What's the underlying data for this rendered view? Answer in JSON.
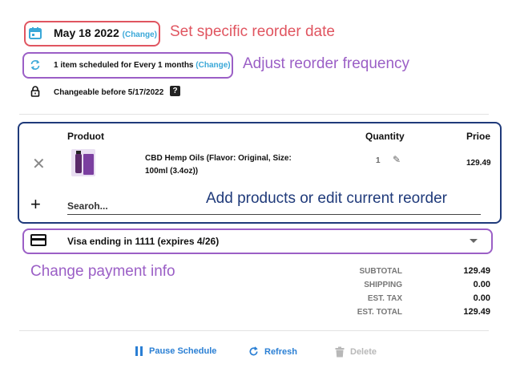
{
  "schedule": {
    "date": "May 18 2022",
    "date_change_label": "Change",
    "frequency_text": "1 item scheduled for Every 1 months",
    "frequency_change_label": "Change",
    "changeable_text": "Changeable before 5/17/2022",
    "help_glyph": "?"
  },
  "annotations": {
    "date": "Set specific reorder date",
    "frequency": "Adjust reorder frequency",
    "products": "Add products or edit current reorder",
    "payment": "Change payment info"
  },
  "table": {
    "headers": {
      "product": "Produot",
      "quantity": "Quantity",
      "price": "Prioe"
    },
    "items": [
      {
        "name": "CBD Hemp Oils (Flavor: Original, Size: 100ml (3.4oz))",
        "quantity": "1",
        "price": "129.49"
      }
    ],
    "search_placeholder": "Searoh..."
  },
  "payment": {
    "text": "Visa ending in 1111 (expires 4/26)"
  },
  "totals": {
    "rows": [
      {
        "label": "SUBTOTAL",
        "value": "129.49"
      },
      {
        "label": "SHIPPING",
        "value": "0.00"
      },
      {
        "label": "EST. TAX",
        "value": "0.00"
      },
      {
        "label": "EST. TOTAL",
        "value": "129.49"
      }
    ]
  },
  "actions": {
    "pause": "Pause Schedule",
    "refresh": "Refresh",
    "delete": "Delete"
  },
  "icons": [
    "calendar-icon",
    "sync-icon",
    "lock-icon",
    "help-icon",
    "close-icon",
    "edit-icon",
    "plus-icon",
    "credit-card-icon",
    "chevron-down-icon",
    "pause-icon",
    "refresh-icon",
    "trash-icon"
  ],
  "colors": {
    "date_accent": "#e05560",
    "frequency_accent": "#9b5fc6",
    "products_accent": "#1f3a7a",
    "link": "#2a7fd4",
    "change_link": "#3aa8d8"
  }
}
